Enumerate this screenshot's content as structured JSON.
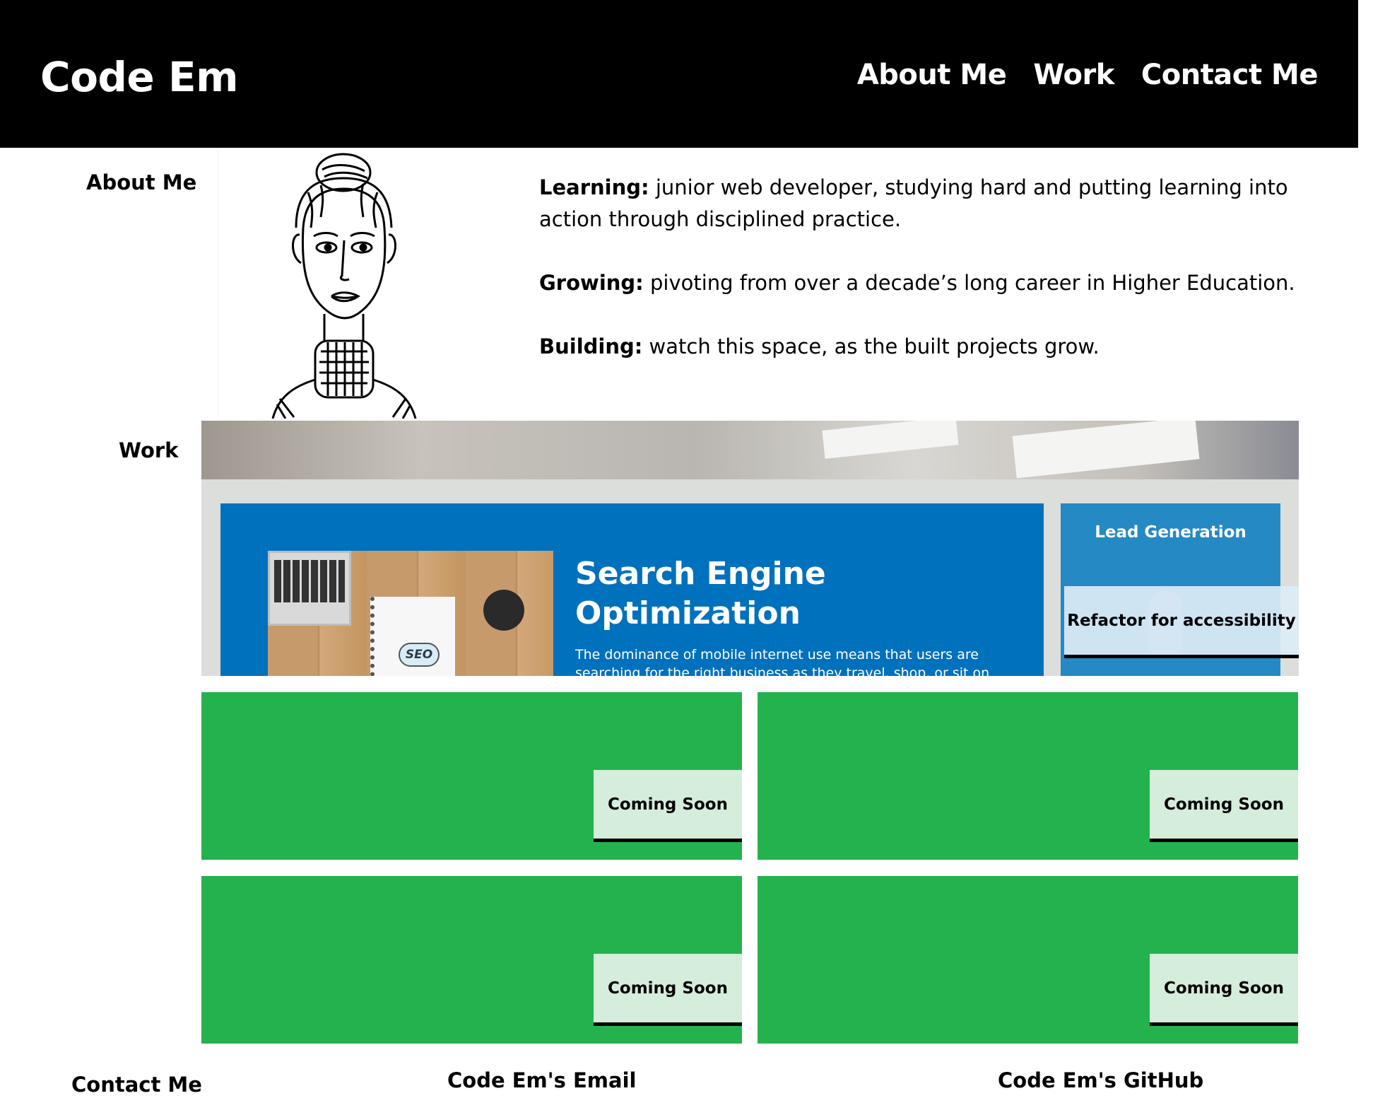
{
  "header": {
    "site_title": "Code Em",
    "nav": [
      "About Me",
      "Work",
      "Contact Me"
    ]
  },
  "about": {
    "label": "About Me",
    "paragraphs": [
      {
        "lead": "Learning:",
        "text": " junior web developer, studying hard and putting learning into action through disciplined practice."
      },
      {
        "lead": "Growing:",
        "text": " pivoting from over a decade’s long career in Higher Education."
      },
      {
        "lead": "Building:",
        "text": " watch this space, as the built projects grow."
      }
    ],
    "avatar_icon": "woman-line-drawing-avatar"
  },
  "work": {
    "label": "Work",
    "featured": {
      "preview_heading": "Search Engine Optimization",
      "preview_copy": "The dominance of mobile internet use means that users are searching for the right business as they travel, shop, or sit on their",
      "side_title": "Lead Generation",
      "seo_word": "SEO",
      "button_label": "Refactor for accessibility"
    },
    "cards": [
      {
        "button_label": "Coming Soon"
      },
      {
        "button_label": "Coming Soon"
      },
      {
        "button_label": "Coming Soon"
      },
      {
        "button_label": "Coming Soon"
      }
    ]
  },
  "contact": {
    "label": "Contact Me",
    "email_label": "Code Em's Email",
    "github_label": "Code Em's GitHub"
  },
  "colors": {
    "header_bg": "#000000",
    "card_green": "#24b24f",
    "button_mint": "#d5eddb",
    "seo_blue": "#0071bc",
    "lead_blue": "#2589c4"
  }
}
